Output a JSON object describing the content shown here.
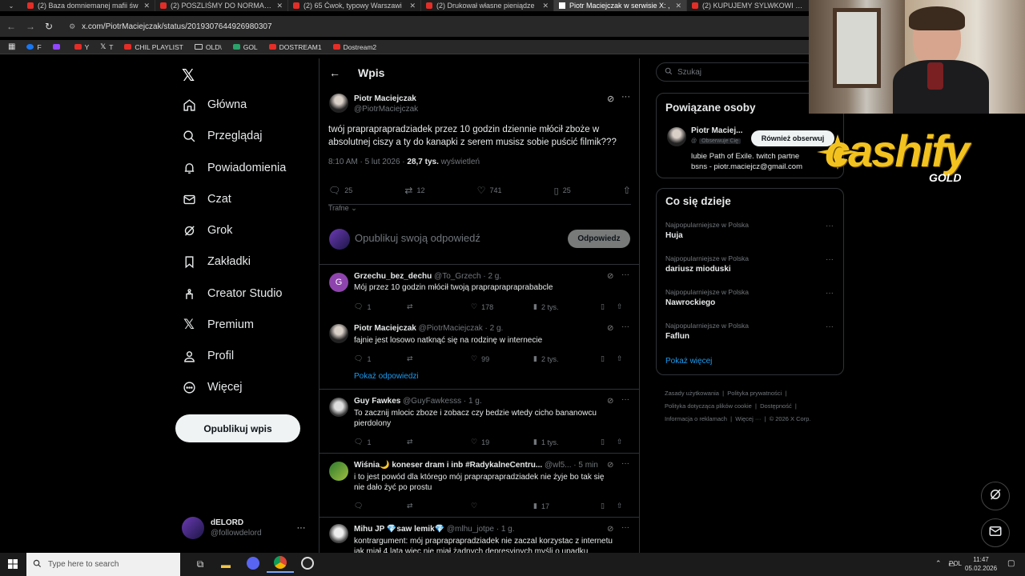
{
  "browser": {
    "tabs": [
      {
        "title": "(2) Baza domniemanej mafii św",
        "active": false,
        "icon": "youtube-icon"
      },
      {
        "title": "(2) POSZLIŚMY DO NORMALNE",
        "active": false,
        "icon": "youtube-icon"
      },
      {
        "title": "(2) 65 Ćwok, typowy Warszawi",
        "active": false,
        "icon": "youtube-icon"
      },
      {
        "title": "(2) Drukował własne pieniądze",
        "active": false,
        "icon": "youtube-icon"
      },
      {
        "title": "Piotr Maciejczak w serwisie X: ,",
        "active": true,
        "icon": "x-icon"
      },
      {
        "title": "(2) KUPUJEMY SYLWKOWI WYP",
        "active": false,
        "icon": "youtube-icon"
      }
    ],
    "url": "x.com/PiotrMaciejczak/status/2019307644926980307",
    "bookmarks": [
      "F",
      "",
      "Y",
      "T",
      "CHIL PLAYLIST",
      "OLD\\",
      "GOL",
      "DOSTREAM1",
      "Dostream2"
    ]
  },
  "nav": {
    "items": [
      {
        "label": "Główna",
        "icon": "home-icon"
      },
      {
        "label": "Przeglądaj",
        "icon": "search-icon"
      },
      {
        "label": "Powiadomienia",
        "icon": "bell-icon"
      },
      {
        "label": "Czat",
        "icon": "mail-icon"
      },
      {
        "label": "Grok",
        "icon": "grok-icon"
      },
      {
        "label": "Zakładki",
        "icon": "bookmark-icon"
      },
      {
        "label": "Creator Studio",
        "icon": "creator-icon"
      },
      {
        "label": "Premium",
        "icon": "x-icon"
      },
      {
        "label": "Profil",
        "icon": "person-icon"
      },
      {
        "label": "Więcej",
        "icon": "more-circle-icon"
      }
    ],
    "post_button": "Opublikuj wpis",
    "account": {
      "name": "dELORD",
      "handle": "@followdelord"
    }
  },
  "post": {
    "header": "Wpis",
    "author": "Piotr Maciejczak",
    "handle": "@PiotrMaciejczak",
    "text_line1": "twój prapraprapradziadek przez 10 godzin dziennie młócił zboże w",
    "text_line2": "absolutnej ciszy a ty do kanapki z serem musisz sobie puścić filmik???",
    "time": "8:10 AM · 5 lut 2026 · ",
    "views": "28,7 tys.",
    "views_label": " wyświetleń",
    "stats": {
      "replies": "25",
      "reposts": "12",
      "likes": "741",
      "bookmarks": "25"
    },
    "sort": "Trafne",
    "reply_placeholder": "Opublikuj swoją odpowiedź",
    "reply_button": "Odpowiedz"
  },
  "replies": [
    {
      "name": "Grzechu_bez_dechu",
      "handle": "@To_Grzech · 2 g.",
      "text": "Mój przez 10 godzin młócił twoją prapraprapraprababcle",
      "replies": "1",
      "likes": "178",
      "views": "2 tys."
    },
    {
      "name": "Piotr Maciejczak",
      "handle": "@PiotrMaciejczak · 2 g.",
      "text": "fajnie jest losowo natknąć się na rodzinę w internecie",
      "replies": "1",
      "likes": "99",
      "views": "2 tys.",
      "show_more": "Pokaż odpowiedzi"
    },
    {
      "name": "Guy Fawkes",
      "handle": "@GuyFawkesss · 1 g.",
      "text": "To zacznij mlocic zboze i zobacz czy bedzie wtedy cicho bananowcu",
      "text2": "pierdolony",
      "replies": "1",
      "likes": "19",
      "views": "1 tys."
    },
    {
      "name": "Wiśnia🌙 koneser dram i inb #RadykalneCentru...",
      "handle": "@wl5... · 5 min",
      "text": "i to jest powód dla którego mój prapraprapradziadek nie żyje bo tak się",
      "text2": "nie dało żyć po prostu",
      "replies": "",
      "likes": "",
      "views": "17"
    },
    {
      "name": "Mihu JP 💎saw lemik💎",
      "handle": "@mlhu_jotpe · 1 g.",
      "text": "kontrargument: mój prapraprapradziadek nie zaczal korzystac z internetu",
      "text2": "jak miał 4 lata więc nie miał żadnych depresyjnych myśli o upadku"
    }
  ],
  "sidebar": {
    "search_placeholder": "Szukaj",
    "related_title": "Powiązane osoby",
    "related": {
      "name": "Piotr Maciej...",
      "follows_you": "Obserwuje Cię",
      "follow_button": "Również obserwuj",
      "bio1": "lubie Path of Exile. twitch partne",
      "bio2": "bsns - piotr.maciejcz@gmail.com"
    },
    "trends_title": "Co się dzieje",
    "trends": [
      {
        "category": "Najpopularniejsze w Polska",
        "name": "Huja"
      },
      {
        "category": "Najpopularniejsze w Polska",
        "name": "dariusz mioduski"
      },
      {
        "category": "Najpopularniejsze w Polska",
        "name": "Nawrockiego"
      },
      {
        "category": "Najpopularniejsze w Polska",
        "name": "Faflun"
      }
    ],
    "show_more": "Pokaż więcej",
    "footer1": [
      "Zasady użytkowania",
      "Polityka prywatności"
    ],
    "footer2": [
      "Polityka dotycząca plików cookie",
      "Dostępność"
    ],
    "footer3": [
      "Informacja o reklamach",
      "Więcej ···",
      "© 2026 X Corp."
    ]
  },
  "overlay": {
    "brand": "cashify",
    "brand_sub": "GOLD",
    "brand_color": "#f3c21f"
  },
  "taskbar": {
    "search_placeholder": "Type here to search",
    "lang": "POL",
    "time": "11:47",
    "date": "05.02.2026"
  }
}
